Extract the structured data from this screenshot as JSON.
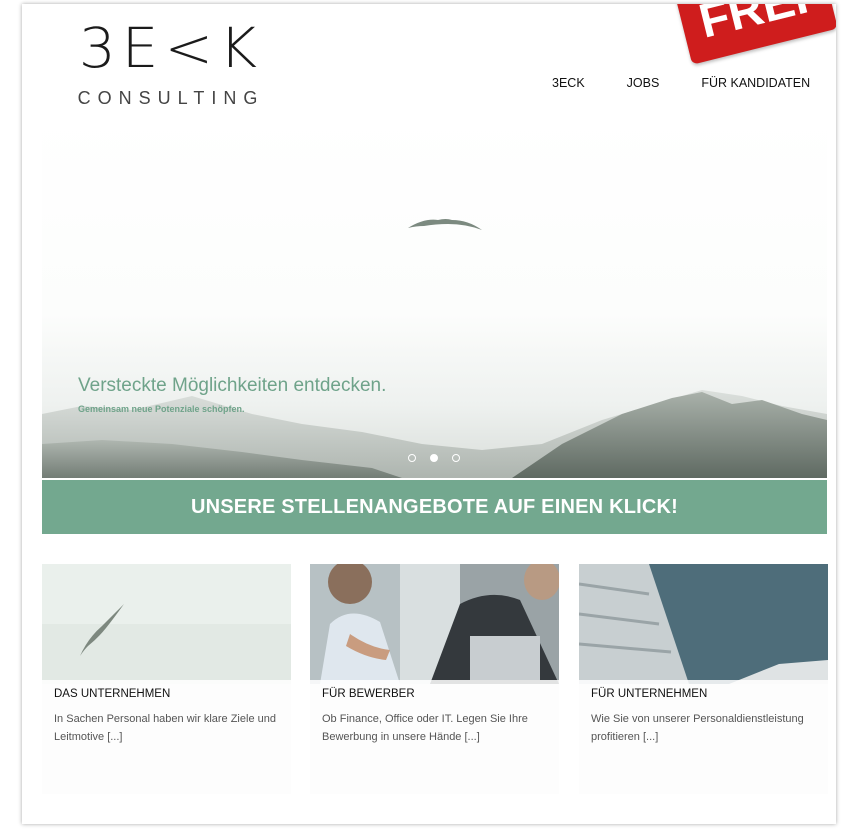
{
  "header": {
    "logo_mark": "3E<K",
    "logo_sub": "CONSULTING",
    "nav": [
      "3ECK",
      "JOBS",
      "FÜR KANDIDATEN"
    ],
    "badge_text": "FREI"
  },
  "hero": {
    "title": "Versteckte Möglichkeiten entdecken.",
    "subtitle": "Gemeinsam neue Potenziale schöpfen.",
    "active_slide": 2,
    "slides_count": 3
  },
  "cta": {
    "label": "UNSERE STELLENANGEBOTE AUF EINEN KLICK!"
  },
  "cards": [
    {
      "title": "DAS UNTERNEHMEN",
      "text": "In Sachen Personal haben wir klare Ziele und Leitmotive [...]"
    },
    {
      "title": "FÜR BEWERBER",
      "text": "Ob Finance, Office oder IT. Legen Sie Ihre Bewerbung in unsere Hände [...]"
    },
    {
      "title": "FÜR UNTERNEHMEN",
      "text": "Wie Sie von unserer Personaldienstleistung profitieren [...]"
    }
  ],
  "colors": {
    "accent": "#73a88f",
    "badge": "#cf1d1d"
  }
}
